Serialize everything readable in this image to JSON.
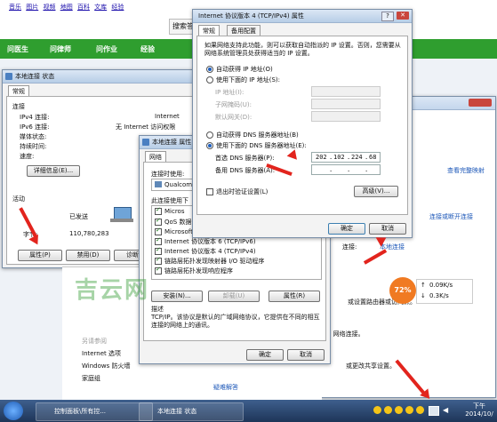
{
  "browser": {
    "nav_links": [
      "音乐",
      "图片",
      "视频",
      "地图",
      "百科",
      "文库",
      "经验"
    ],
    "search_button": "搜索答",
    "green_tabs": [
      "问医生",
      "问律师",
      "问作业",
      "经验"
    ]
  },
  "status_window": {
    "title": "本地连接 状态",
    "tab_general": "常规",
    "section_connection": "连接",
    "rows": [
      {
        "label": "IPv4 连接:",
        "value": "Internet"
      },
      {
        "label": "IPv6 连接:",
        "value": "无 Internet 访问权限"
      },
      {
        "label": "媒体状态:",
        "value": ""
      },
      {
        "label": "持续时间:",
        "value": ""
      },
      {
        "label": "速度:",
        "value": ""
      }
    ],
    "details_button": "详细信息(E)...",
    "section_activity": "活动",
    "sent_label": "已发送",
    "bytes_label": "字节:",
    "bytes_value": "110,780,283",
    "properties_button": "属性(P)",
    "disable_button": "禁用(D)",
    "diagnose_button": "诊断"
  },
  "properties_window": {
    "title": "本地连接 属性",
    "tab_network": "网络",
    "connect_using_label": "连接时使用:",
    "adapter_name": "Qualcom",
    "items_label": "此连接使用下",
    "items": [
      "Micros",
      "QoS 数据包计划程序",
      "Microsoft 网络的文件和打印机共享",
      "Internet 协议版本 6 (TCP/IPv6)",
      "Internet 协议版本 4 (TCP/IPv4)",
      "链路层拓扑发现映射器 I/O 驱动程序",
      "链路层拓扑发现响应程序"
    ],
    "install_button": "安装(N)...",
    "uninstall_button": "卸载(U)",
    "properties_button": "属性(R)",
    "desc_title": "描述",
    "desc_text": "TCP/IP。该协议是默认的广域网络协议，它提供在不同的相互连接的网络上的通讯。",
    "ok_button": "确定",
    "cancel_button": "取消"
  },
  "ipv4_window": {
    "title": "Internet 协议版本 4 (TCP/IPv4) 属性",
    "tab_general": "常规",
    "tab_alternate": "备用配置",
    "intro": "如果网络支持此功能，则可以获取自动指派的 IP 设置。否则，您需要从网络系统管理员处获得适当的 IP 设置。",
    "auto_ip": "自动获得 IP 地址(O)",
    "manual_ip": "使用下面的 IP 地址(S):",
    "ip_label": "IP 地址(I):",
    "mask_label": "子网掩码(U):",
    "gateway_label": "默认网关(D):",
    "auto_dns": "自动获得 DNS 服务器地址(B)",
    "manual_dns": "使用下面的 DNS 服务器地址(E):",
    "pref_dns_label": "首选 DNS 服务器(P):",
    "pref_dns": [
      "202",
      "102",
      "224",
      "68"
    ],
    "alt_dns_label": "备用 DNS 服务器(A):",
    "alt_dns": [
      "",
      "",
      "",
      ""
    ],
    "validate": "退出时验证设置(L)",
    "advanced_button": "高级(V)...",
    "ok_button": "确定",
    "cancel_button": "取消"
  },
  "network_center": {
    "links": [
      "查看完整映射",
      "连接或断开连接"
    ],
    "local_link": "本地连接",
    "connect_label": "连接:",
    "router_text": "或设置路由器或访问点。",
    "vpn_text": "PN 网络连接。",
    "share_text": "或更改共享设置。",
    "see_also": "另请参阅",
    "see_also_items": [
      "Internet 选项",
      "Windows 防火墙",
      "家庭组"
    ],
    "troubleshoot": "疑难解答"
  },
  "speed_widget": {
    "percent": "72%",
    "up": "0.09K/s",
    "down": "0.3K/s"
  },
  "watermark": "吉云网",
  "taskbar": {
    "buttons": [
      "控制面板\\所有控...",
      "本地连接 状态"
    ],
    "time": "下午",
    "date": "2014/10/"
  },
  "colors": {
    "accent_green": "#2f9e2f",
    "arrow_red": "#e2241d",
    "link_blue": "#1c57b8",
    "speed_orange": "#f07a22"
  }
}
